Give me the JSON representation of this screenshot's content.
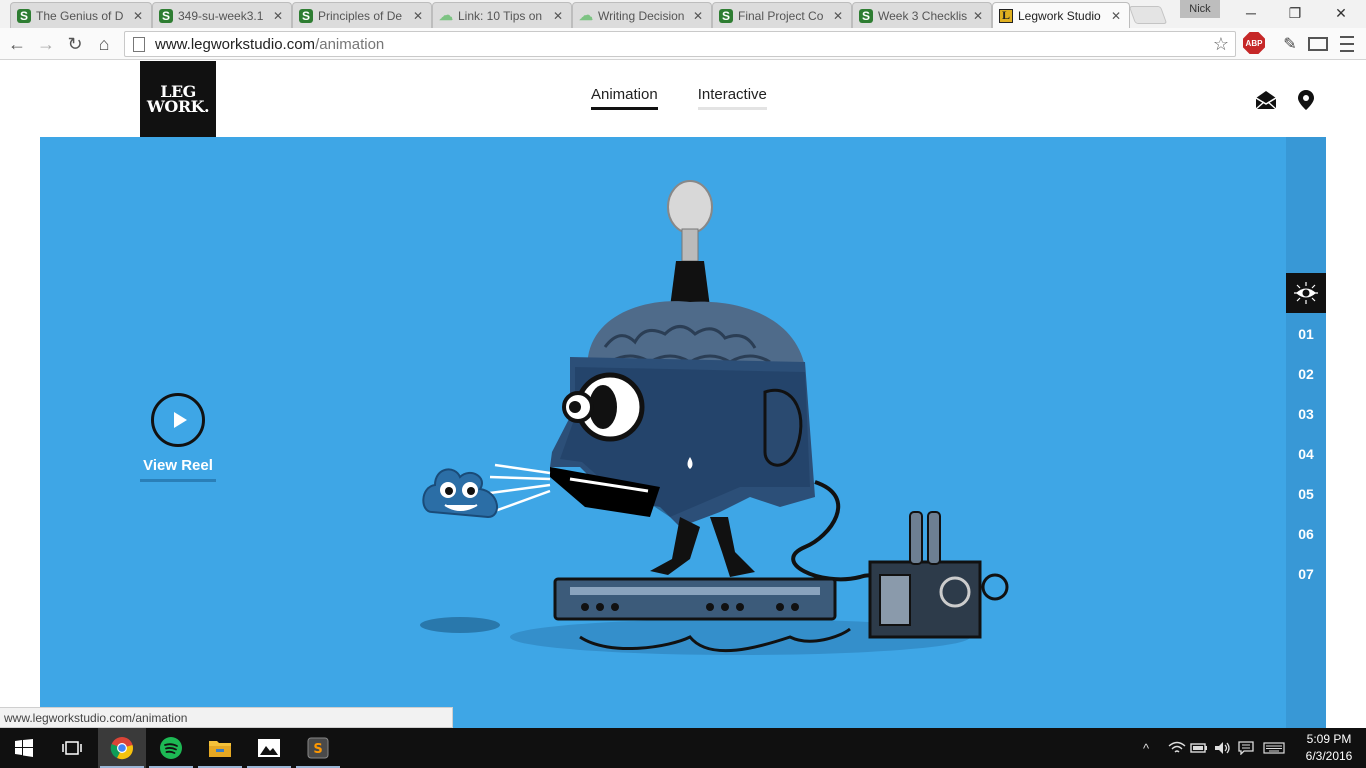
{
  "browser": {
    "tabs": [
      {
        "title": "The Genius of D",
        "favicon": "s-icon"
      },
      {
        "title": "349-su-week3.1",
        "favicon": "s-icon"
      },
      {
        "title": "Principles of De",
        "favicon": "s-icon"
      },
      {
        "title": "Link: 10 Tips on",
        "favicon": "cloud-icon"
      },
      {
        "title": "Writing Decision",
        "favicon": "cloud-icon"
      },
      {
        "title": "Final Project Co",
        "favicon": "s-icon"
      },
      {
        "title": "Week 3 Checklis",
        "favicon": "s-icon"
      },
      {
        "title": "Legwork Studio",
        "favicon": "legwork-favicon-icon",
        "active": true
      }
    ],
    "profile_name": "Nick",
    "url_host": "www.legworkstudio.com",
    "url_path": "/animation",
    "extension_label": "ABP",
    "status_url": "www.legworkstudio.com/animation"
  },
  "site": {
    "logo_line1": "LEG",
    "logo_line2": "WORK.",
    "nav": [
      {
        "label": "Animation",
        "active": true
      },
      {
        "label": "Interactive",
        "active": false
      }
    ],
    "reel_label": "View Reel",
    "rail_items": [
      "01",
      "02",
      "03",
      "04",
      "05",
      "06",
      "07"
    ],
    "hero_color": "#3ea6e6"
  },
  "taskbar": {
    "time": "5:09 PM",
    "date": "6/3/2016",
    "pinned": [
      "windows-start-icon",
      "task-view-icon",
      "chrome-icon",
      "spotify-icon",
      "file-explorer-icon",
      "photos-icon",
      "sublime-text-icon"
    ]
  }
}
